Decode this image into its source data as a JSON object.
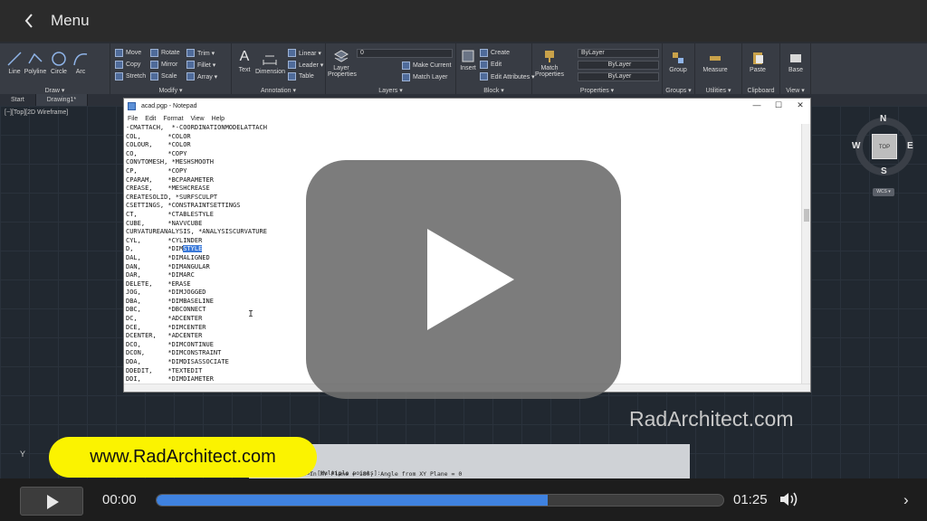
{
  "menu": {
    "back_icon": "chevron-left-icon",
    "title": "Menu"
  },
  "ribbon": {
    "draw": {
      "label": "Draw ▾",
      "tools": [
        "Line",
        "Polyline",
        "Circle",
        "Arc"
      ]
    },
    "modify": {
      "label": "Modify ▾",
      "tools": [
        "Move",
        "Rotate",
        "Trim ▾",
        "Copy",
        "Mirror",
        "Fillet ▾",
        "Stretch",
        "Scale",
        "Array ▾"
      ]
    },
    "annotation": {
      "label": "Annotation ▾",
      "tools": [
        "Text",
        "Dimension",
        "Linear ▾",
        "Leader ▾",
        "Table"
      ]
    },
    "layers": {
      "label": "Layers ▾",
      "tools": [
        "Layer Properties",
        "Make Current",
        "Match Layer"
      ],
      "layer_value": "0"
    },
    "block": {
      "label": "Block ▾",
      "tools": [
        "Insert",
        "Create",
        "Edit",
        "Edit Attributes ▾"
      ]
    },
    "properties": {
      "label": "Properties ▾",
      "tools": [
        "Match Properties"
      ],
      "bylayer": [
        "ByLayer",
        "ByLayer",
        "ByLayer"
      ]
    },
    "groups": {
      "label": "Groups ▾",
      "tools": [
        "Group"
      ]
    },
    "utilities": {
      "label": "Utilities ▾",
      "tools": [
        "Measure"
      ]
    },
    "clipboard": {
      "label": "Clipboard",
      "tools": [
        "Paste"
      ]
    },
    "view": {
      "label": "View ▾",
      "tools": [
        "Base"
      ]
    }
  },
  "tabs": [
    "Start",
    "Drawing1*"
  ],
  "viewport_label": "[−][Top][2D Wireframe]",
  "viewcube": {
    "n": "N",
    "s": "S",
    "e": "E",
    "w": "W",
    "top": "TOP",
    "wcs": "WCS ▾"
  },
  "notepad": {
    "title": "acad.pgp - Notepad",
    "controls": [
      "—",
      "☐",
      "✕"
    ],
    "menu": [
      "File",
      "Edit",
      "Format",
      "View",
      "Help"
    ],
    "lines": [
      "-CMATTACH,  *-COORDINATIONMODELATTACH",
      "COL,       *COLOR",
      "COLOUR,    *COLOR",
      "CO,        *COPY",
      "CONVTOMESH, *MESHSMOOTH",
      "CP,        *COPY",
      "CPARAM,    *BCPARAMETER",
      "CREASE,    *MESHCREASE",
      "CREATESOLID, *SURFSCULPT",
      "CSETTINGS, *CONSTRAINTSETTINGS",
      "CT,        *CTABLESTYLE",
      "CUBE,      *NAVVCUBE",
      "CURVATUREANALYSIS, *ANALYSISCURVATURE",
      "CYL,       *CYLINDER",
      "D,         *DIMSTYLE",
      "DAL,       *DIMALIGNED",
      "DAN,       *DIMANGULAR",
      "DAR,       *DIMARC",
      "DELETE,    *ERASE",
      "JOG,       *DIMJOGGED",
      "DBA,       *DIMBASELINE",
      "DBC,       *DBCONNECT",
      "DC,        *ADCENTER",
      "DCE,       *DIMCENTER",
      "DCENTER,   *ADCENTER",
      "DCO,       *DIMCONTINUE",
      "DCON,      *DIMCONSTRAINT",
      "DDA,       *DIMDISASSOCIATE",
      "DDEDIT,    *TEXTEDIT",
      "DDI,       *DIMDIAMETER"
    ],
    "highlight": {
      "line_prefix": "D,         *DIM",
      "selected": "STYLE"
    }
  },
  "watermark": "RadArchitect.com",
  "url_badge": "www.RadArchitect.com",
  "command_line": [
    "      or [Multiple points]:",
    "   ,  Angle in XY Plane = 180,  Angle from XY Plane = 0"
  ],
  "ucs_label": "Y",
  "player": {
    "current_time": "00:00",
    "duration": "01:25",
    "progress": 0.69
  }
}
